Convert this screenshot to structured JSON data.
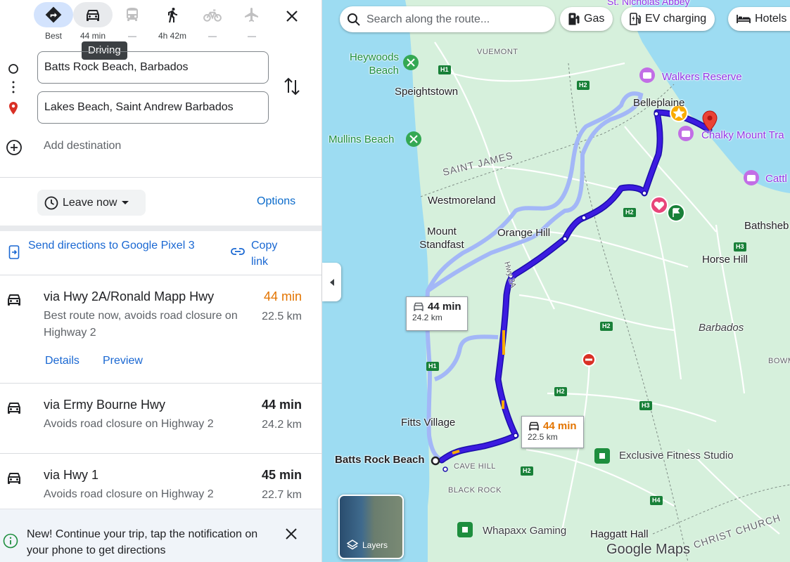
{
  "travel_modes": [
    {
      "name": "Best",
      "label": "Best",
      "icon": "diamond-directions-icon"
    },
    {
      "name": "Driving",
      "label": "44 min",
      "icon": "car-icon"
    },
    {
      "name": "Transit",
      "label": "—",
      "icon": "bus-icon"
    },
    {
      "name": "Walking",
      "label": "4h 42m",
      "icon": "walking-icon"
    },
    {
      "name": "Cycling",
      "label": "—",
      "icon": "bicycle-icon"
    },
    {
      "name": "Flights",
      "label": "—",
      "icon": "airplane-icon"
    }
  ],
  "tooltip": "Driving",
  "waypoints": {
    "origin": "Batts Rock Beach, Barbados",
    "destination": "Lakes Beach, Saint Andrew Barbados",
    "add_destination": "Add destination"
  },
  "leave_now": "Leave now",
  "options": "Options",
  "send_directions": "Send directions to Google Pixel 3",
  "copy_link": "Copy link",
  "routes": [
    {
      "name": "via Hwy 2A/Ronald Mapp Hwy",
      "time": "44 min",
      "distance": "22.5 km",
      "description": "Best route now, avoids road closure on Highway 2",
      "details": "Details",
      "preview": "Preview"
    },
    {
      "name": "via Ermy Bourne Hwy",
      "time": "44 min",
      "distance": "24.2 km",
      "description": "Avoids road closure on Highway 2"
    },
    {
      "name": "via Hwy 1",
      "time": "45 min",
      "distance": "22.7 km",
      "description": "Avoids road closure on Highway 2"
    }
  ],
  "notice": "New! Continue your trip, tap the notification on your phone to get directions",
  "map": {
    "search_placeholder": "Search along the route...",
    "chips": {
      "gas": "Gas",
      "ev": "EV charging",
      "hotels": "Hotels"
    },
    "labels": {
      "vuemont": "VUEMONT",
      "heywoods": "Heywoods Beach",
      "speightstown": "Speightstown",
      "mullins": "Mullins Beach",
      "saint_james": "SAINT JAMES",
      "westmoreland": "Westmoreland",
      "mount_standfast": "Mount Standfast",
      "orange_hill": "Orange Hill",
      "belleplaine": "Belleplaine",
      "walkers": "Walkers Reserve",
      "chalky": "Chalky Mount Tra",
      "cattl": "Cattl",
      "bathsheba": "Bathsheb",
      "horse_hill": "Horse Hill",
      "barbados": "Barbados",
      "bowm": "BOWM",
      "fitts": "Fitts Village",
      "batts": "Batts Rock Beach",
      "cave_hill": "CAVE HILL",
      "black_rock": "BLACK ROCK",
      "exclusive": "Exclusive Fitness Studio",
      "whapaxx": "Whapaxx Gaming",
      "haggatt": "Haggatt Hall",
      "christ_church": "CHRIST CHURCH",
      "st_nicholas": "St. Nicholas Abbey",
      "hwy2a": "Hwy 2A"
    },
    "highways": {
      "h1": "H1",
      "h2": "H2",
      "h3": "H3",
      "h4": "H4"
    },
    "callout_alt": {
      "time": "44 min",
      "distance": "24.2 km"
    },
    "callout_best": {
      "time": "44 min",
      "distance": "22.5 km"
    },
    "layers": "Layers",
    "logo": "Google Maps",
    "colors": {
      "route_primary": "#3c1be0",
      "route_alt": "#a3b7f7",
      "water": "#9ddcf2",
      "land": "#d6f0dc"
    }
  }
}
